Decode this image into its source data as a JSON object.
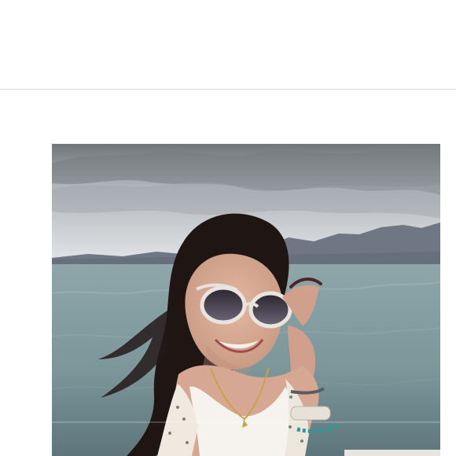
{
  "page": {
    "background": "#ffffff"
  },
  "photo": {
    "subject": "woman-with-sunglasses",
    "colors": {
      "sky_top": "#75787d",
      "sky_bottom": "#e2e4e6",
      "mountains": "#6c7382",
      "water_top": "#849ca0",
      "water_bottom": "#5f767c",
      "hair": "#1f1512",
      "skin": "#d8aa92",
      "sunglasses_frame": "#e7e3df",
      "lens": "#3c3642",
      "top": "#f4f1ec",
      "watch_band": "#e8e1d7",
      "bracelet": "#2c9a9b"
    }
  }
}
